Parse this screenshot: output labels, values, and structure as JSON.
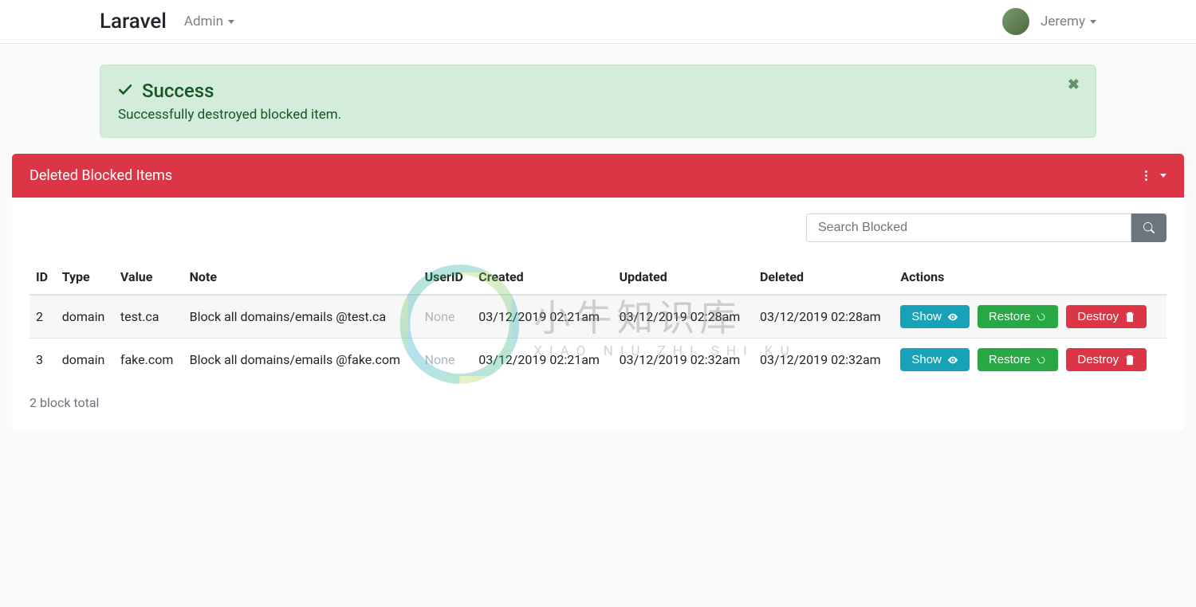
{
  "navbar": {
    "brand": "Laravel",
    "admin_label": "Admin",
    "user_name": "Jeremy"
  },
  "alert": {
    "title": "Success",
    "message": "Successfully destroyed blocked item."
  },
  "card": {
    "title": "Deleted Blocked Items"
  },
  "search": {
    "placeholder": "Search Blocked"
  },
  "table": {
    "headers": {
      "id": "ID",
      "type": "Type",
      "value": "Value",
      "note": "Note",
      "userid": "UserID",
      "created": "Created",
      "updated": "Updated",
      "deleted": "Deleted",
      "actions": "Actions"
    },
    "rows": [
      {
        "id": "2",
        "type": "domain",
        "value": "test.ca",
        "note": "Block all domains/emails @test.ca",
        "userid": "None",
        "created": "03/12/2019 02:21am",
        "updated": "03/12/2019 02:28am",
        "deleted": "03/12/2019 02:28am"
      },
      {
        "id": "3",
        "type": "domain",
        "value": "fake.com",
        "note": "Block all domains/emails @fake.com",
        "userid": "None",
        "created": "03/12/2019 02:21am",
        "updated": "03/12/2019 02:32am",
        "deleted": "03/12/2019 02:32am"
      }
    ]
  },
  "actions": {
    "show": "Show",
    "restore": "Restore",
    "destroy": "Destroy"
  },
  "footer": {
    "count_text": "2 block total"
  },
  "watermark": {
    "cn": "小牛知识库",
    "en": "XIAO NIU ZHI SHI KU"
  }
}
